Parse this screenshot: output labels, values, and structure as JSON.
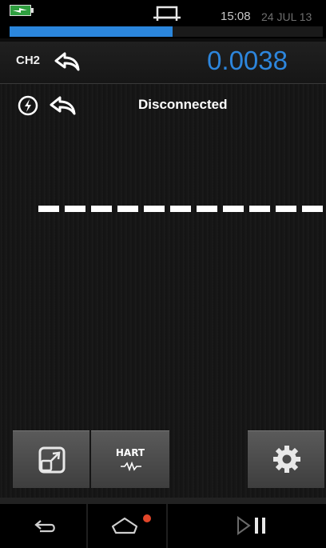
{
  "status_bar": {
    "time": "15:08",
    "date": "24 JUL 13",
    "progress_percent": 52,
    "icons": [
      "battery-charging-icon",
      "connector-icon"
    ]
  },
  "channel": {
    "label": "CH2",
    "value": "0.0038",
    "value_color": "#2d86dd",
    "icon": "back-arrow-icon"
  },
  "main": {
    "status_text": "Disconnected",
    "icons": [
      "power-icon",
      "back-arrow-icon"
    ],
    "reading_dash_count": 11
  },
  "toolbar": {
    "expand_icon": "expand-icon",
    "hart_label": "HART",
    "hart_icon": "waveform-icon",
    "settings_icon": "gear-icon"
  },
  "nav_bar": {
    "icons": [
      "back-icon",
      "home-icon",
      "play-pause-icon"
    ],
    "notification_color": "#e2462a",
    "accent_color": "#2b86dc"
  }
}
